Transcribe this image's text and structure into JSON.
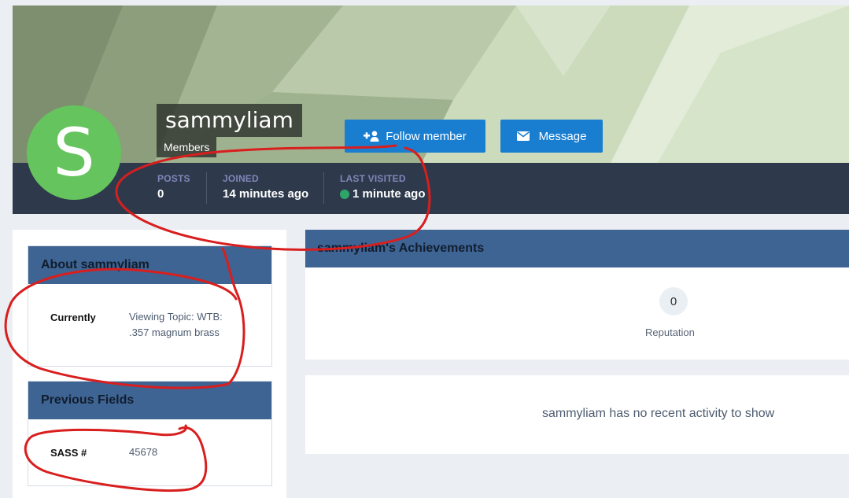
{
  "profile": {
    "avatar_letter": "S",
    "username": "sammyliam",
    "group": "Members",
    "avatar_color": "#66c45e"
  },
  "actions": {
    "follow_label": "Follow member",
    "message_label": "Message",
    "accent": "#1a7ed0"
  },
  "stats": {
    "posts_label": "POSTS",
    "posts_value": "0",
    "joined_label": "JOINED",
    "joined_value": "14 minutes ago",
    "last_visited_label": "LAST VISITED",
    "last_visited_value": "1 minute ago"
  },
  "about": {
    "title": "About sammyliam",
    "currently_label": "Currently",
    "currently_value_line1": "Viewing Topic: WTB:",
    "currently_value_line2": ".357 magnum brass"
  },
  "previous_fields": {
    "title": "Previous Fields",
    "sass_label": "SASS #",
    "sass_value": "45678"
  },
  "achievements": {
    "title": "sammyliam's Achievements",
    "reputation_value": "0",
    "reputation_label": "Reputation"
  },
  "activity": {
    "empty_message": "sammyliam has no recent activity to show"
  },
  "icons": {
    "follow": "user-plus-icon",
    "message": "envelope-icon",
    "online": "online-status-dot"
  },
  "colors": {
    "header_bar": "#2e3a4c",
    "widget_header": "#3e6493",
    "annotation": "#d91e1e"
  }
}
